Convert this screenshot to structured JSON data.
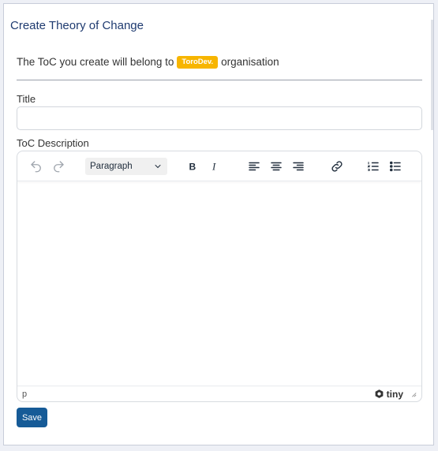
{
  "page": {
    "title": "Create Theory of Change",
    "belong_prefix": "The ToC you create will belong to",
    "org_badge": "ToroDev.",
    "belong_suffix": "organisation"
  },
  "form": {
    "title_label": "Title",
    "title_value": "",
    "title_placeholder": "",
    "description_label": "ToC Description",
    "save_label": "Save"
  },
  "editor": {
    "format_selected": "Paragraph",
    "toolbar_icons": [
      "undo-icon",
      "redo-icon",
      "bold-icon",
      "italic-icon",
      "align-left-icon",
      "align-center-icon",
      "align-right-icon",
      "link-icon",
      "ordered-list-icon",
      "bullet-list-icon"
    ],
    "status_path": "p",
    "brand": "tiny"
  },
  "colors": {
    "title": "#1f3b70",
    "badge": "#f7b500",
    "save_button": "#165b97"
  }
}
